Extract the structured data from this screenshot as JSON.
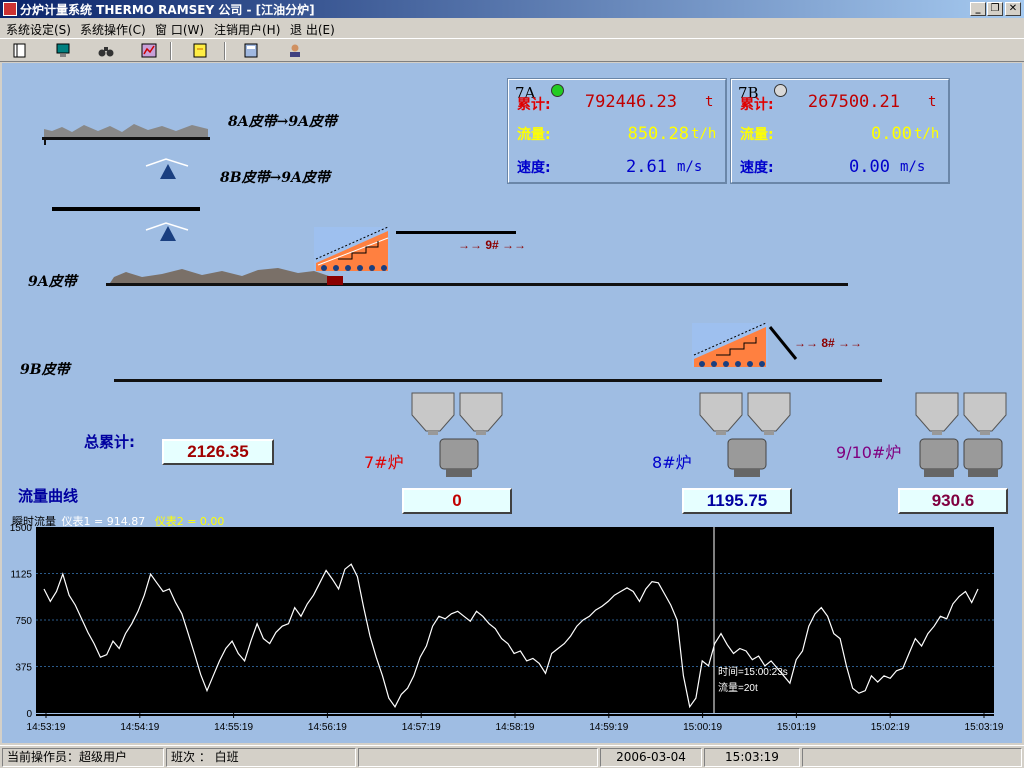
{
  "window": {
    "title": "分炉计量系统 THERMO RAMSEY 公司 - [江油分炉]",
    "buttons": {
      "minimize": "_",
      "restore": "❐",
      "close": "✕"
    }
  },
  "menu": {
    "items": [
      "系统设定(S)",
      "系统操作(C)",
      "窗 口(W)",
      "注销用户(H)",
      "退 出(E)"
    ]
  },
  "toolbar": {
    "icons": [
      "book-icon",
      "monitor-icon",
      "binoculars-icon",
      "chart-icon",
      "note-icon",
      "calculator-icon",
      "user-icon"
    ]
  },
  "belts": {
    "label_8a_to_9a": "8A皮带→9A皮带",
    "label_8b_to_9a": "8B皮带→9A皮带",
    "label_9a": "9A皮带",
    "label_9b": "9B皮带",
    "arrow_9": "→→ 9# →→",
    "arrow_8": "→→ 8# →→"
  },
  "scales": {
    "a": {
      "name": "7A",
      "led_color": "#22cc22",
      "total_label": "累计:",
      "total_value": "792446.23",
      "total_unit": "t",
      "flow_label": "流量:",
      "flow_value": "850.28",
      "flow_unit": "t/h",
      "speed_label": "速度:",
      "speed_value": "2.61",
      "speed_unit": "m/s"
    },
    "b": {
      "name": "7B",
      "led_color": "#d8d8d8",
      "total_label": "累计:",
      "total_value": "267500.21",
      "total_unit": "t",
      "flow_label": "流量:",
      "flow_value": "0.00",
      "flow_unit": "t/h",
      "speed_label": "速度:",
      "speed_value": "0.00",
      "speed_unit": "m/s"
    }
  },
  "totals": {
    "label": "总累计:",
    "value": "2126.35"
  },
  "furnaces": [
    {
      "label": "7#炉",
      "color": "#e00000",
      "value": "0",
      "value_color": "#c00000"
    },
    {
      "label": "8#炉",
      "color": "#0000cc",
      "value": "1195.75",
      "value_color": "#0000a0"
    },
    {
      "label": "9/10#炉",
      "color": "#800080",
      "value": "930.6",
      "value_color": "#800040"
    }
  ],
  "chart_section": {
    "title": "流量曲线",
    "legend_prefix": "瞬时流量",
    "legend_1": "仪表1 = 914.87",
    "legend_2": "仪表2 =   0.00",
    "cursor_time": "时间=15:00:23s",
    "cursor_flow": "流量=20t"
  },
  "chart_data": {
    "type": "line",
    "title": "",
    "xlabel": "",
    "ylabel": "",
    "ylim": [
      0,
      1500
    ],
    "yticks": [
      0,
      375,
      750,
      1125,
      1500
    ],
    "xticks": [
      "14:53:19",
      "14:54:19",
      "14:55:19",
      "14:56:19",
      "14:57:19",
      "14:58:19",
      "14:59:19",
      "15:00:19",
      "15:01:19",
      "15:02:19",
      "15:03:19"
    ],
    "grid": "horizontal dotted",
    "series": [
      {
        "values": [
          1000,
          900,
          980,
          1120,
          950,
          870,
          760,
          650,
          560,
          450,
          470,
          580,
          520,
          640,
          720,
          820,
          950,
          1120,
          1050,
          980,
          1000,
          890,
          800,
          640,
          480,
          310,
          180,
          300,
          420,
          520,
          580,
          480,
          420,
          580,
          720,
          600,
          560,
          650,
          700,
          720,
          850,
          780,
          880,
          950,
          1050,
          1150,
          1080,
          1000,
          1160,
          1200,
          1100,
          850,
          620,
          450,
          300,
          120,
          50,
          150,
          200,
          300,
          450,
          540,
          700,
          780,
          760,
          800,
          820,
          780,
          740,
          820,
          780,
          720,
          680,
          600,
          560,
          480,
          500,
          420,
          440,
          400,
          320,
          480,
          520,
          560,
          620,
          700,
          750,
          780,
          830,
          860,
          900,
          950,
          980,
          1010,
          980,
          900,
          1000,
          1060,
          1050,
          960,
          870,
          750,
          300,
          50,
          120,
          420,
          380,
          560,
          640,
          550,
          480,
          520,
          500,
          430,
          460,
          380,
          420,
          360,
          300,
          240,
          430,
          500,
          700,
          800,
          850,
          780,
          640,
          600,
          380,
          200,
          160,
          180,
          300,
          250,
          300,
          280,
          340,
          360,
          480,
          600,
          540,
          640,
          700,
          780,
          760,
          880,
          940,
          980,
          890,
          1000
        ]
      }
    ]
  },
  "status": {
    "operator": "当前操作员：超级用户",
    "shift": "班次 ：  白班",
    "date": "2006-03-04",
    "time": "15:03:19"
  }
}
